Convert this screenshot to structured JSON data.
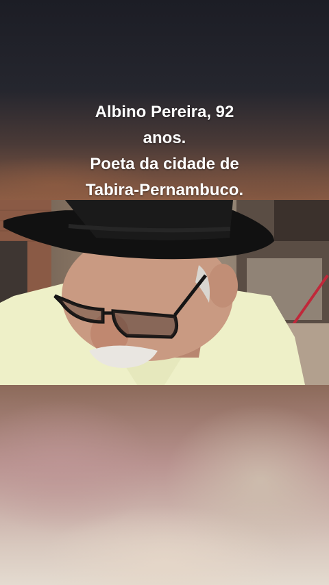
{
  "caption": {
    "line1": "Albino Pereira, 92",
    "line2": "anos.",
    "line3": "Poeta da cidade de",
    "line4": "Tabira-Pernambuco."
  },
  "colors": {
    "caption_text": "#ffffff",
    "hat": "#111111",
    "shirt": "#eef0c8",
    "skin": "#c99a82"
  }
}
